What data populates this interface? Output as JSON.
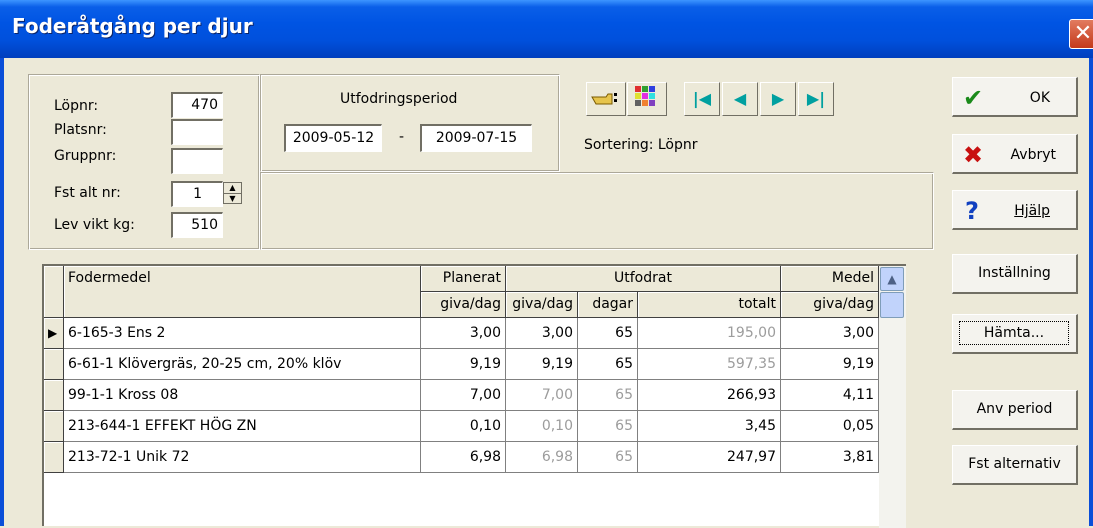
{
  "window": {
    "title": "Foderåtgång per djur",
    "close_glyph": "✕"
  },
  "animal": {
    "lopnr_label": "Löpnr:",
    "lopnr_value": "470",
    "platsnr_label": "Platsnr:",
    "platsnr_value": "",
    "gruppnr_label": "Gruppnr:",
    "gruppnr_value": "",
    "fst_label": "Fst alt nr:",
    "fst_value": "1",
    "levvikt_label": "Lev vikt kg:",
    "levvikt_value": "510"
  },
  "period": {
    "label": "Utfodringsperiod",
    "from": "2009-05-12",
    "sep": "-",
    "to": "2009-07-15"
  },
  "sorting": {
    "text": "Sortering: Löpnr"
  },
  "nav": {
    "first": "|◀",
    "prev": "◀",
    "next": "▶",
    "last": "▶|"
  },
  "buttons": {
    "ok": "OK",
    "cancel": "Avbryt",
    "help": "Hjälp",
    "settings": "Inställning",
    "fetch": "Hämta...",
    "use_period": "Anv period",
    "fst_alt": "Fst alternativ"
  },
  "table": {
    "headers": {
      "fodermedel": "Fodermedel",
      "planerat_top": "Planerat",
      "planerat_sub": "giva/dag",
      "utfodrat_top": "Utfodrat",
      "giva_sub": "giva/dag",
      "dagar_sub": "dagar",
      "totalt_sub": "totalt",
      "medel_top": "Medel",
      "medel_sub": "giva/dag"
    },
    "rows": [
      {
        "name": "6-165-3 Ens 2",
        "planerat": "3,00",
        "giva": "3,00",
        "dagar": "65",
        "totalt": "195,00",
        "medel": "3,00"
      },
      {
        "name": "6-61-1 Klövergräs, 20-25 cm, 20% klöv",
        "planerat": "9,19",
        "giva": "9,19",
        "dagar": "65",
        "totalt": "597,35",
        "medel": "9,19"
      },
      {
        "name": "99-1-1 Kross 08",
        "planerat": "7,00",
        "giva": "7,00",
        "dagar": "65",
        "totalt": "266,93",
        "medel": "4,11"
      },
      {
        "name": "213-644-1 EFFEKT HÖG ZN",
        "planerat": "0,10",
        "giva": "0,10",
        "dagar": "65",
        "totalt": "3,45",
        "medel": "0,05"
      },
      {
        "name": "213-72-1 Unik 72",
        "planerat": "6,98",
        "giva": "6,98",
        "dagar": "65",
        "totalt": "247,97",
        "medel": "3,81"
      }
    ]
  }
}
